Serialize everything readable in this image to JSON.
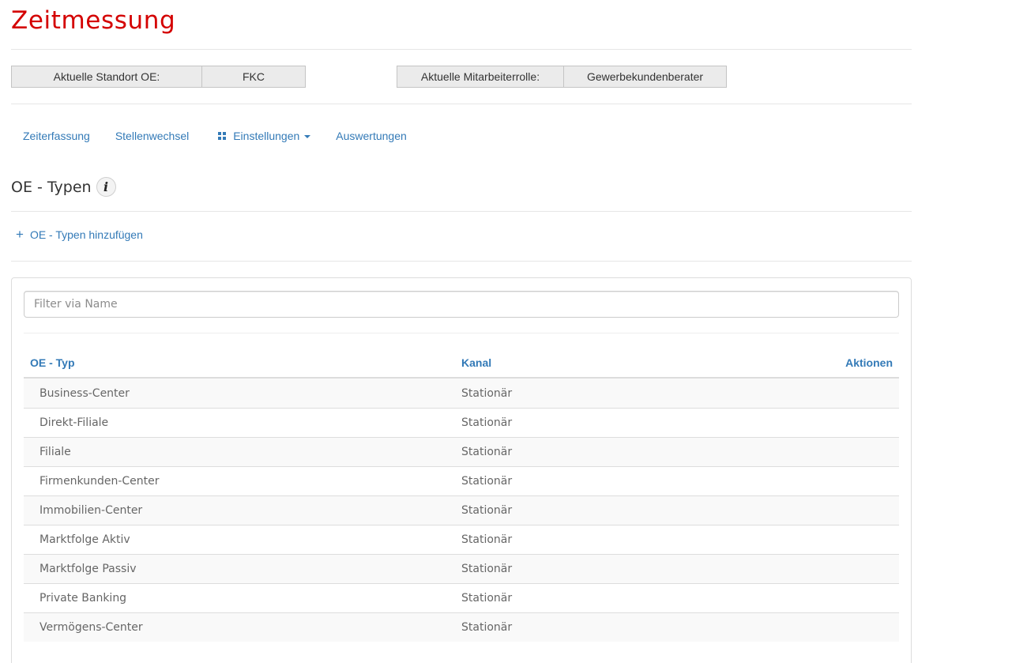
{
  "app": {
    "title": "Zeitmessung"
  },
  "info": {
    "standort_label": "Aktuelle Standort OE:",
    "standort_value": "FKC",
    "rolle_label": "Aktuelle Mitarbeiterrolle:",
    "rolle_value": "Gewerbekundenberater"
  },
  "nav": {
    "items": [
      {
        "label": "Zeiterfassung"
      },
      {
        "label": "Stellenwechsel"
      },
      {
        "label": "Einstellungen",
        "icon": "grid-icon",
        "dropdown": true
      },
      {
        "label": "Auswertungen"
      }
    ]
  },
  "section": {
    "title": "OE - Typen",
    "icon": "info-icon",
    "info_glyph": "i"
  },
  "add": {
    "label": "OE - Typen hinzufügen",
    "icon": "plus-icon",
    "glyph": "+"
  },
  "filter": {
    "placeholder": "Filter via Name",
    "value": ""
  },
  "table": {
    "headers": [
      "OE - Typ",
      "Kanal",
      "Aktionen"
    ],
    "rows": [
      {
        "typ": "Business-Center",
        "kanal": "Stationär"
      },
      {
        "typ": "Direkt-Filiale",
        "kanal": "Stationär"
      },
      {
        "typ": "Filiale",
        "kanal": "Stationär"
      },
      {
        "typ": "Firmenkunden-Center",
        "kanal": "Stationär"
      },
      {
        "typ": "Immobilien-Center",
        "kanal": "Stationär"
      },
      {
        "typ": "Marktfolge Aktiv",
        "kanal": "Stationär"
      },
      {
        "typ": "Marktfolge Passiv",
        "kanal": "Stationär"
      },
      {
        "typ": "Private Banking",
        "kanal": "Stationär"
      },
      {
        "typ": "Vermögens-Center",
        "kanal": "Stationär"
      }
    ]
  },
  "colors": {
    "brand": "#d40000",
    "link": "#337ab7"
  }
}
